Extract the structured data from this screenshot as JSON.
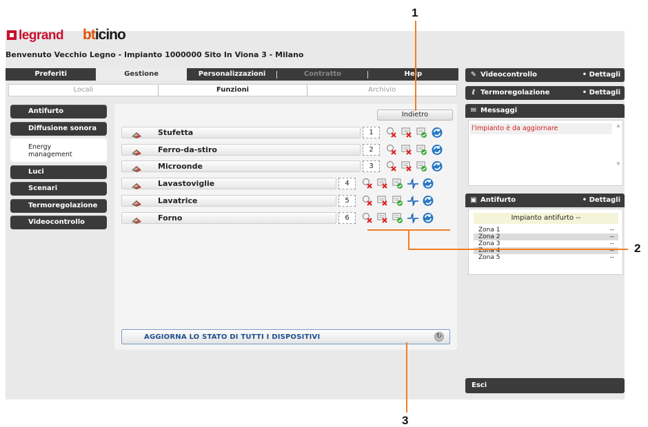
{
  "callouts": {
    "c1": "1",
    "c2": "2",
    "c3": "3"
  },
  "brand": {
    "legrand": "legrand",
    "bticino_b": "bt",
    "bticino_rest": "icino"
  },
  "welcome": "Benvenuto Vecchio Legno - Impianto 1000000 Sito In Viona 3 - Milano",
  "topnav": [
    {
      "label": "Preferiti"
    },
    {
      "label": "Gestione"
    },
    {
      "label": "Personalizzazioni"
    },
    {
      "label": "Contratto"
    },
    {
      "label": "Help"
    }
  ],
  "subnav": [
    {
      "label": "Locali"
    },
    {
      "label": "Funzioni"
    },
    {
      "label": "Archivio"
    }
  ],
  "sidemenu": [
    {
      "label": "Antifurto"
    },
    {
      "label": "Diffusione sonora"
    },
    {
      "label": "Energy management"
    },
    {
      "label": "Luci"
    },
    {
      "label": "Scenari"
    },
    {
      "label": "Termoregolazione"
    },
    {
      "label": "Videocontrollo"
    }
  ],
  "back_label": "Indietro",
  "devices": [
    {
      "name": "Stufetta",
      "num": "1"
    },
    {
      "name": "Ferro-da-stiro",
      "num": "2"
    },
    {
      "name": "Microonde",
      "num": "3"
    },
    {
      "name": "Lavastoviglie",
      "num": "4"
    },
    {
      "name": "Lavatrice",
      "num": "5"
    },
    {
      "name": "Forno",
      "num": "6"
    }
  ],
  "update_label": "AGGIORNA LO STATO DI TUTTI I DISPOSITIVI",
  "right": {
    "video": "Videocontrollo",
    "termo": "Termoregolazione",
    "details": "• Dettagli",
    "messages_title": "Messaggi",
    "message": "l'impianto è da aggiornare",
    "antifurto_title": "Antifurto",
    "antifurto_status": "Impianto antifurto --",
    "zones": [
      {
        "name": "Zona 1",
        "state": "--"
      },
      {
        "name": "Zona 2",
        "state": "--"
      },
      {
        "name": "Zona 3",
        "state": "--"
      },
      {
        "name": "Zona 4",
        "state": "--"
      },
      {
        "name": "Zona 5",
        "state": "--"
      }
    ],
    "exit": "Esci"
  },
  "colors": {
    "accent": "#ef7d23",
    "dark": "#3b3b3b",
    "brand_red": "#c8102e",
    "link_blue": "#1f4e8c",
    "alert_red": "#d32020"
  }
}
